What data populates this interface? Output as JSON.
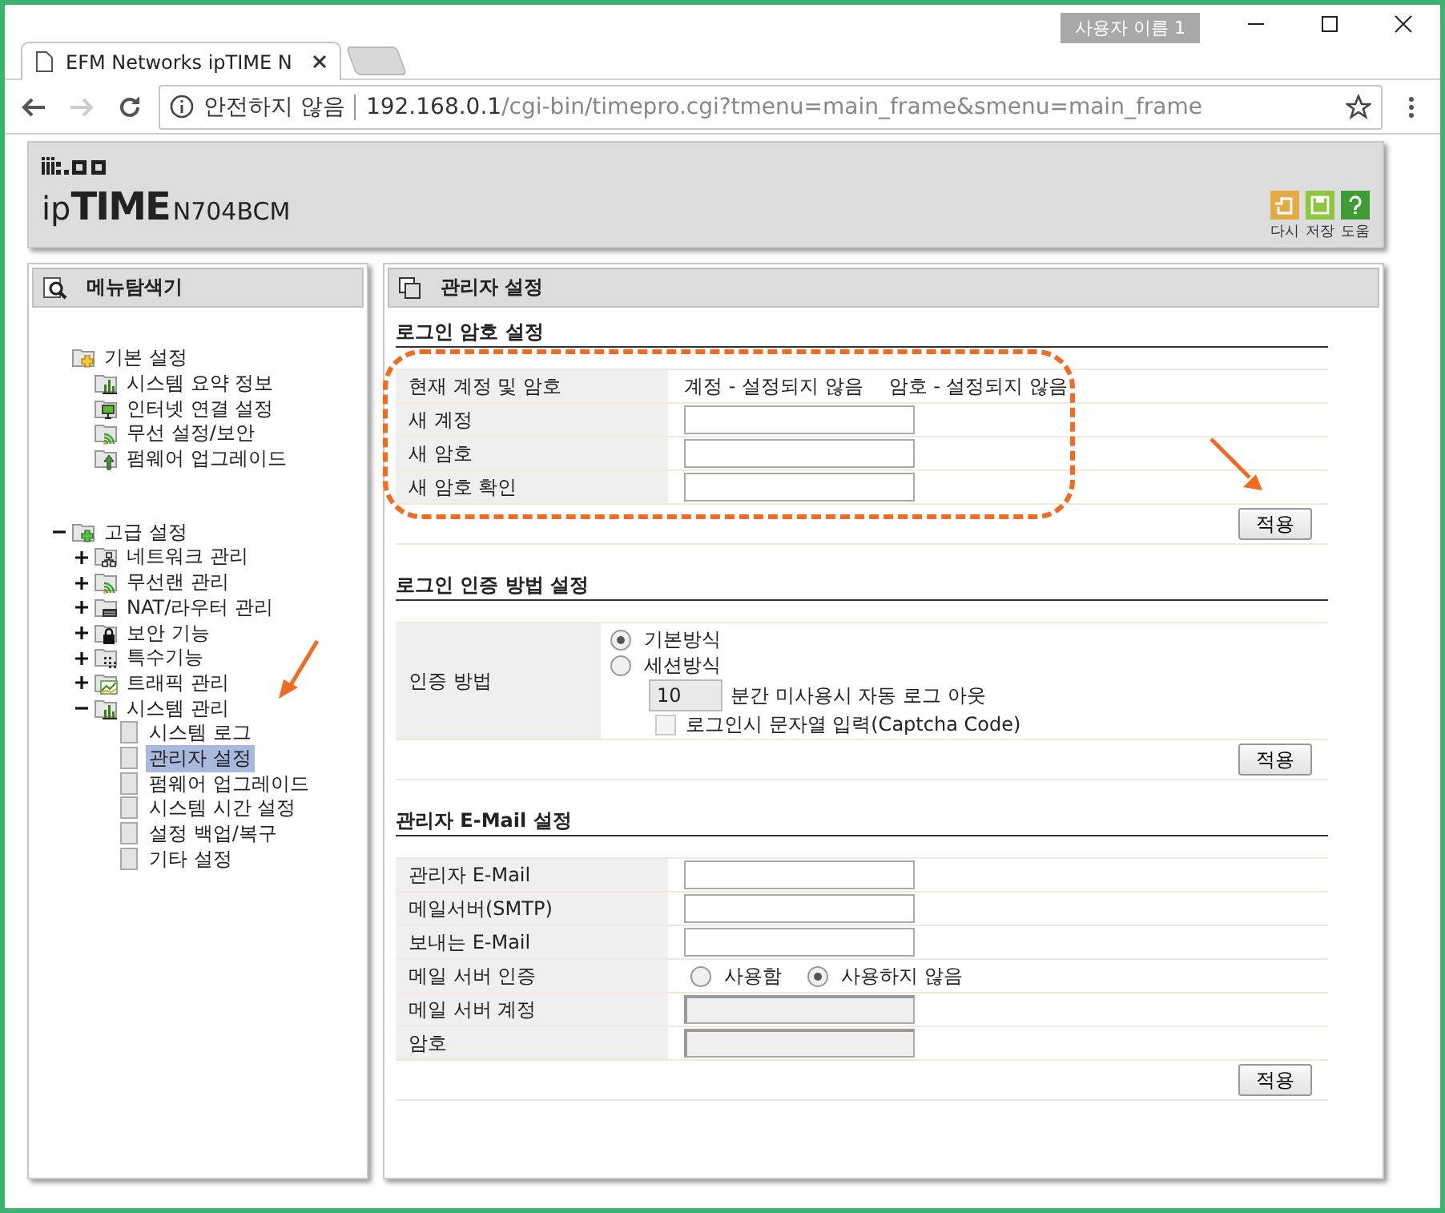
{
  "browser": {
    "profile": "사용자 이름 1",
    "tab": {
      "title": "EFM Networks ipTIME N"
    },
    "address": {
      "security": "안전하지 않음",
      "host": "192.168.0.1",
      "path": "/cgi-bin/timepro.cgi?tmenu=main_frame&smenu=main_frame"
    }
  },
  "header": {
    "brand": "ip**TIME**",
    "model": "N704BCM",
    "actions": [
      {
        "kind": "reset",
        "label": "다시"
      },
      {
        "kind": "save",
        "label": "저장"
      },
      {
        "kind": "help",
        "label": "도움"
      }
    ]
  },
  "sidebar": {
    "title": "메뉴탐색기",
    "groups": [
      {
        "label": "기본 설정",
        "kind": "basic",
        "selected": false,
        "children": [
          {
            "label": "시스템 요약 정보",
            "kind": "chart",
            "selected": false
          },
          {
            "label": "인터넷 연결 설정",
            "kind": "monitor",
            "selected": false
          },
          {
            "label": "무선 설정/보안",
            "kind": "wifi",
            "selected": false
          },
          {
            "label": "펌웨어 업그레이드",
            "kind": "upgrade",
            "selected": false
          }
        ]
      },
      {
        "label": "고급 설정",
        "kind": "advanced",
        "expanded": true,
        "selected": false,
        "children": [
          {
            "label": "네트워크 관리",
            "kind": "network",
            "expanded": false,
            "selected": false
          },
          {
            "label": "무선랜 관리",
            "kind": "wifi",
            "expanded": false,
            "selected": false
          },
          {
            "label": "NAT/라우터 관리",
            "kind": "router",
            "expanded": false,
            "selected": false
          },
          {
            "label": "보안 기능",
            "kind": "lock",
            "expanded": false,
            "selected": false
          },
          {
            "label": "특수기능",
            "kind": "special",
            "expanded": false,
            "selected": false
          },
          {
            "label": "트래픽 관리",
            "kind": "traffic",
            "expanded": false,
            "selected": false
          },
          {
            "label": "시스템 관리",
            "kind": "chart",
            "expanded": true,
            "selected": false,
            "children": [
              {
                "label": "시스템 로그",
                "kind": "page",
                "selected": false
              },
              {
                "label": "관리자 설정",
                "kind": "page",
                "selected": true
              },
              {
                "label": "펌웨어 업그레이드",
                "kind": "page",
                "selected": false
              },
              {
                "label": "시스템 시간 설정",
                "kind": "page",
                "selected": false
              },
              {
                "label": "설정 백업/복구",
                "kind": "page",
                "selected": false
              },
              {
                "label": "기타 설정",
                "kind": "page",
                "selected": false
              }
            ]
          }
        ]
      }
    ]
  },
  "main": {
    "title": "관리자 설정",
    "sections": [
      {
        "title": "로그인 암호 설정",
        "highlighted": true,
        "button": "적용",
        "rows": [
          {
            "kind": "text",
            "label": "현재 계정 및 암호",
            "values": [
              "계정 - 설정되지 않음",
              "암호 - 설정되지 않음"
            ]
          },
          {
            "kind": "input",
            "label": "새 계정",
            "disabled": false
          },
          {
            "kind": "input",
            "label": "새 암호",
            "disabled": false
          },
          {
            "kind": "input",
            "label": "새 암호 확인",
            "disabled": false
          }
        ]
      },
      {
        "title": "로그인 인증 방법 설정",
        "highlighted": false,
        "button": "적용",
        "rows": [
          {
            "kind": "auth",
            "label": "인증 방법",
            "options": [
              {
                "label": "기본방식",
                "selected": true
              },
              {
                "label": "세션방식",
                "selected": false
              }
            ],
            "timeout": {
              "value": "10",
              "text": "분간 미사용시 자동 로그 아웃"
            },
            "captcha": {
              "label": "로그인시 문자열 입력(Captcha Code)",
              "checked": false,
              "disabled": true
            }
          }
        ]
      },
      {
        "title": "관리자 E-Mail 설정",
        "highlighted": false,
        "button": "적용",
        "rows": [
          {
            "kind": "input",
            "label": "관리자 E-Mail",
            "disabled": false
          },
          {
            "kind": "input",
            "label": "메일서버(SMTP)",
            "disabled": false
          },
          {
            "kind": "input",
            "label": "보내는 E-Mail",
            "disabled": false
          },
          {
            "kind": "radio",
            "label": "메일 서버 인증",
            "options": [
              {
                "label": "사용함",
                "selected": false
              },
              {
                "label": "사용하지 않음",
                "selected": true
              }
            ]
          },
          {
            "kind": "input",
            "label": "메일 서버 계정",
            "disabled": true
          },
          {
            "kind": "input",
            "label": "암호",
            "disabled": true
          }
        ]
      }
    ]
  }
}
